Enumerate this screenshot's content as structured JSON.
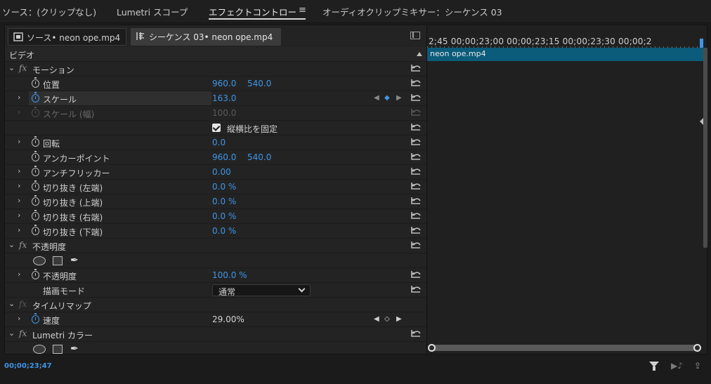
{
  "panel_tabs": {
    "source": "ソース：(クリップなし)",
    "lumetri_scopes": "Lumetri スコープ",
    "effect_controls": "エフェクトコントロー",
    "audio_mixer": "オーディオクリップミキサー：シーケンス 03"
  },
  "clip_tabs": {
    "source_clip": "ソース• neon ope.mp4",
    "sequence_clip": "シーケンス 03• neon ope.mp4"
  },
  "section_label": "ビデオ",
  "effects": {
    "motion": {
      "name": "モーション",
      "position": {
        "label": "位置",
        "x": "960.0",
        "y": "540.0"
      },
      "scale": {
        "label": "スケール",
        "value": "163.0"
      },
      "scale_width": {
        "label": "スケール (幅)",
        "value": "100.0"
      },
      "uniform_scale": {
        "label": "縦横比を固定",
        "checked": true
      },
      "rotation": {
        "label": "回転",
        "value": "0.0"
      },
      "anchor": {
        "label": "アンカーポイント",
        "x": "960.0",
        "y": "540.0"
      },
      "flicker": {
        "label": "アンチフリッカー",
        "value": "0.00"
      },
      "crop_left": {
        "label": "切り抜き (左端)",
        "value": "0.0 %"
      },
      "crop_top": {
        "label": "切り抜き (上端)",
        "value": "0.0 %"
      },
      "crop_right": {
        "label": "切り抜き (右端)",
        "value": "0.0 %"
      },
      "crop_bottom": {
        "label": "切り抜き (下端)",
        "value": "0.0 %"
      }
    },
    "opacity": {
      "name": "不透明度",
      "opacity": {
        "label": "不透明度",
        "value": "100.0 %"
      },
      "blend_mode": {
        "label": "描画モード",
        "value": "通常"
      }
    },
    "time_remap": {
      "name": "タイムリマップ",
      "speed": {
        "label": "速度",
        "value": "29.00%"
      }
    },
    "lumetri": {
      "name": "Lumetri カラー"
    }
  },
  "timeline": {
    "ruler": "2;45  00;00;23;00  00;00;23;15  00;00;23;30  00;00;2",
    "clip_name": "neon ope.mp4"
  },
  "status": {
    "timecode": "00;00;23;47"
  },
  "colors": {
    "accent": "#3f95e6",
    "clip": "#0b5b7a"
  },
  "icons": [
    "stopwatch-icon",
    "reset-icon",
    "filter-icon",
    "play-only-audio-icon",
    "export-frame-icon",
    "panel-menu-icon"
  ]
}
